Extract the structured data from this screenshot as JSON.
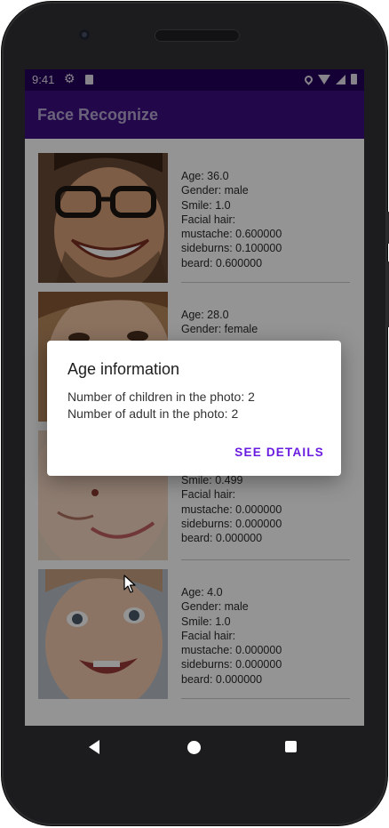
{
  "status_bar": {
    "time": "9:41"
  },
  "app_bar": {
    "title": "Face Recognize"
  },
  "faces": [
    {
      "age": "Age: 36.0",
      "gender": "Gender: male",
      "smile": "Smile: 1.0",
      "facial_hair": "Facial hair:",
      "mustache": "mustache: 0.600000",
      "sideburns": "sideburns: 0.100000",
      "beard": "beard: 0.600000"
    },
    {
      "age": "Age: 28.0",
      "gender": "Gender: female"
    },
    {
      "smile": "Smile: 0.499",
      "facial_hair": "Facial hair:",
      "mustache": "mustache: 0.000000",
      "sideburns": "sideburns: 0.000000",
      "beard": "beard: 0.000000"
    },
    {
      "age": "Age: 4.0",
      "gender": "Gender: male",
      "smile": "Smile: 1.0",
      "facial_hair": "Facial hair:",
      "mustache": "mustache: 0.000000",
      "sideburns": "sideburns: 0.000000",
      "beard": "beard: 0.000000"
    }
  ],
  "dialog": {
    "title": "Age information",
    "line1": "Number of children in the photo: 2",
    "line2": "Number of adult in the photo: 2",
    "button": "SEE DETAILS"
  },
  "colors": {
    "status_bar": "#24005a",
    "app_bar": "#3b0d82",
    "accent": "#6a1be0"
  },
  "icons": [
    "settings-gear-icon",
    "sim-card-icon",
    "location-icon",
    "wifi-icon",
    "signal-icon",
    "battery-icon",
    "back-icon",
    "home-icon",
    "recents-icon",
    "mouse-cursor-icon"
  ]
}
